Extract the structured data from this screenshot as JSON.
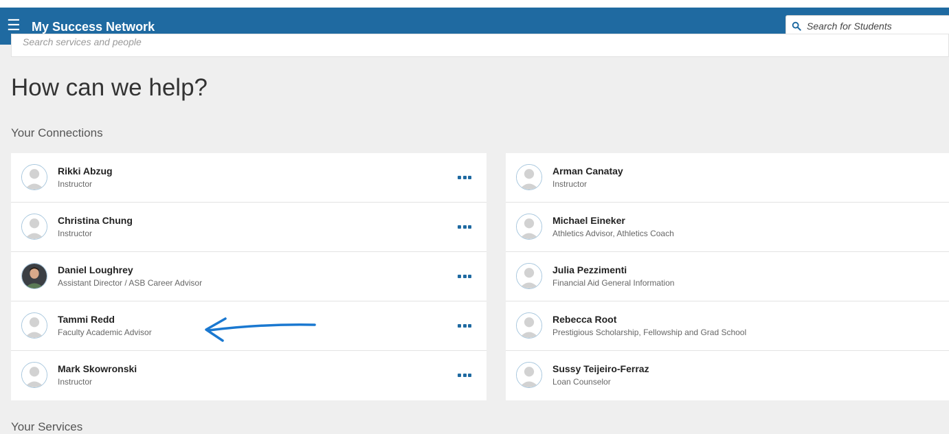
{
  "header": {
    "menu_icon": "hamburger-icon",
    "title": "My Success Network",
    "student_search_placeholder": "Search for Students",
    "search_icon": "search-icon"
  },
  "services_search": {
    "placeholder": "Search services and people"
  },
  "page_title": "How can we help?",
  "connections_heading": "Your Connections",
  "connections_left": [
    {
      "name": "Rikki Abzug",
      "role": "Instructor"
    },
    {
      "name": "Christina Chung",
      "role": "Instructor"
    },
    {
      "name": "Daniel Loughrey",
      "role": "Assistant Director / ASB Career Advisor",
      "photo": true
    },
    {
      "name": "Tammi Redd",
      "role": "Faculty Academic Advisor"
    },
    {
      "name": "Mark Skowronski",
      "role": "Instructor"
    }
  ],
  "connections_right": [
    {
      "name": "Arman Canatay",
      "role": "Instructor"
    },
    {
      "name": "Michael Eineker",
      "role": "Athletics Advisor, Athletics Coach"
    },
    {
      "name": "Julia Pezzimenti",
      "role": "Financial Aid General Information"
    },
    {
      "name": "Rebecca Root",
      "role": "Prestigious Scholarship, Fellowship and Grad School"
    },
    {
      "name": "Sussy Teijeiro-Ferraz",
      "role": "Loan Counselor"
    }
  ],
  "services_heading": "Your Services",
  "colors": {
    "brand": "#1f6aa1",
    "annotation_arrow": "#1a78d0"
  }
}
